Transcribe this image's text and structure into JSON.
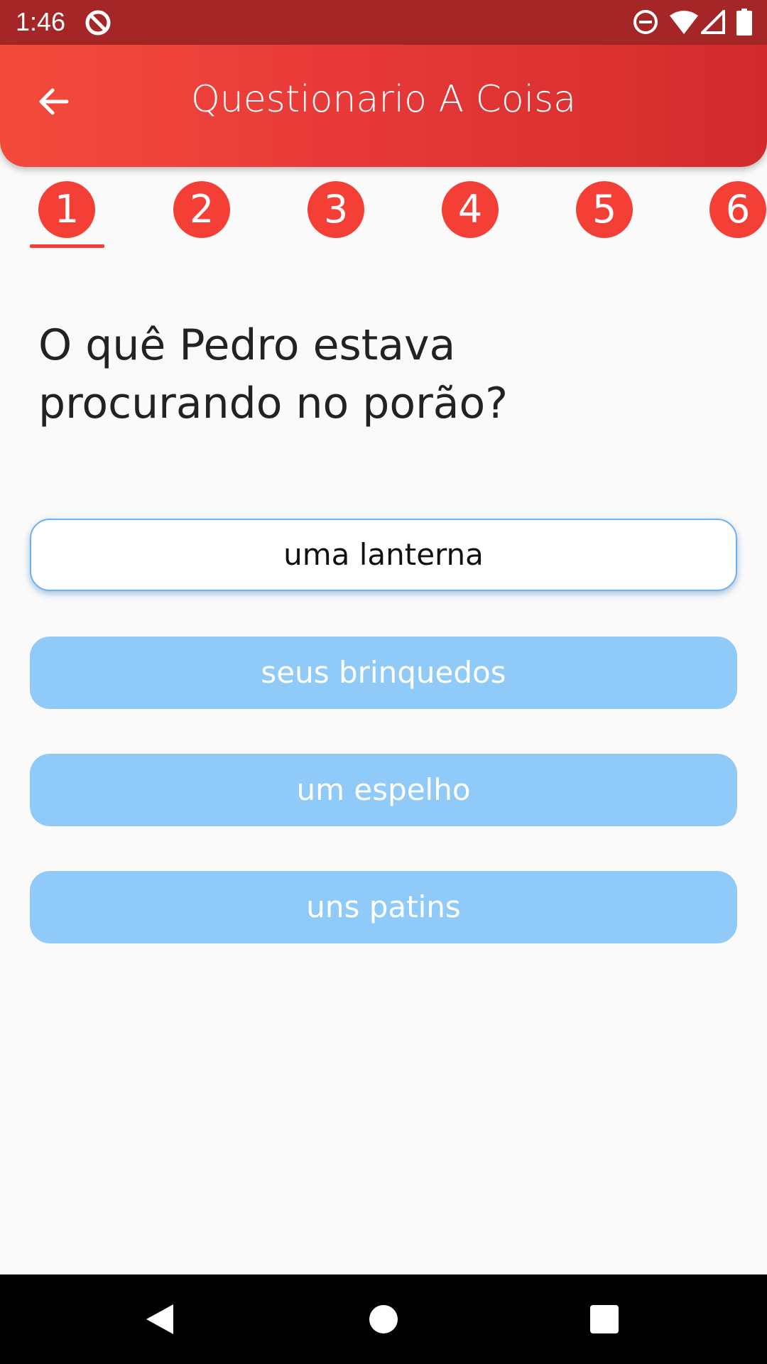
{
  "status_bar": {
    "time": "1:46",
    "icons": [
      "sync-disabled-icon",
      "do-not-disturb-icon",
      "wifi-icon",
      "signal-icon",
      "battery-icon"
    ]
  },
  "app_bar": {
    "title": "Questionario A Coisa",
    "back_icon": "arrow-left-icon"
  },
  "tabs": [
    {
      "label": "1",
      "selected": true
    },
    {
      "label": "2",
      "selected": false
    },
    {
      "label": "3",
      "selected": false
    },
    {
      "label": "4",
      "selected": false
    },
    {
      "label": "5",
      "selected": false
    },
    {
      "label": "6",
      "selected": false
    }
  ],
  "question": {
    "text": " O quê Pedro estava\nprocurando no porão?"
  },
  "answers": [
    {
      "label": "uma lanterna",
      "selected": true
    },
    {
      "label": "seus brinquedos",
      "selected": false
    },
    {
      "label": "um espelho",
      "selected": false
    },
    {
      "label": "uns patins",
      "selected": false
    }
  ],
  "nav_bar": {
    "icons": [
      "back-triangle-icon",
      "home-circle-icon",
      "recents-square-icon"
    ]
  },
  "colors": {
    "primary_red": "#F43F36",
    "status_bar": "#A52626",
    "answer_blue": "#90CAF9",
    "selected_border": "#6DB2EE",
    "background": "#FAFAFA"
  }
}
